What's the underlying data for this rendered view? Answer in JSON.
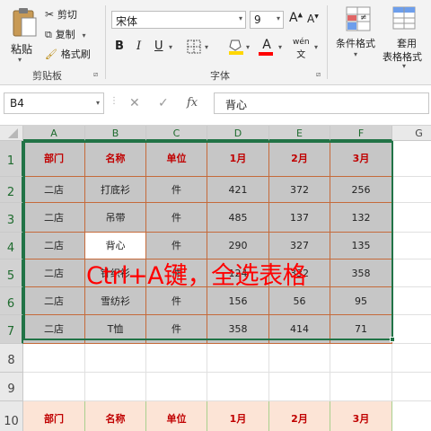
{
  "clipboard": {
    "paste": "粘贴",
    "cut": "剪切",
    "copy": "复制",
    "format_painter": "格式刷",
    "group_label": "剪贴板"
  },
  "font": {
    "name": "宋体",
    "size": "9",
    "bold": "B",
    "italic": "I",
    "underline": "U",
    "grow": "A",
    "shrink": "A",
    "font_color": "A",
    "wen": "wén",
    "group_label": "字体"
  },
  "styles": {
    "conditional": "条件格式",
    "table_format_1": "套用",
    "table_format_2": "表格格式"
  },
  "formula_bar": {
    "name_box": "B4",
    "fx": "fx",
    "content": "背心"
  },
  "columns": [
    "A",
    "B",
    "C",
    "D",
    "E",
    "F",
    "G"
  ],
  "rows": [
    "1",
    "2",
    "3",
    "4",
    "5",
    "6",
    "7",
    "8",
    "9",
    "10"
  ],
  "table1": {
    "header": [
      "部门",
      "名称",
      "单位",
      "1月",
      "2月",
      "3月"
    ],
    "body": [
      [
        "二店",
        "打底衫",
        "件",
        "421",
        "372",
        "256"
      ],
      [
        "二店",
        "吊带",
        "件",
        "485",
        "137",
        "132"
      ],
      [
        "二店",
        "背心",
        "件",
        "290",
        "327",
        "135"
      ],
      [
        "二店",
        "针织衫",
        "件",
        "124",
        "332",
        "358"
      ],
      [
        "二店",
        "雪纺衫",
        "件",
        "156",
        "56",
        "95"
      ],
      [
        "二店",
        "T恤",
        "件",
        "358",
        "414",
        "71"
      ]
    ]
  },
  "table2": {
    "header": [
      "部门",
      "名称",
      "单位",
      "1月",
      "2月",
      "3月"
    ]
  },
  "annotation": "Ctrl+A键，全选表格",
  "colors": {
    "selection": "#c6c6c6",
    "accent": "#217346",
    "header_text": "#c00000",
    "annotation": "#ff0000"
  }
}
